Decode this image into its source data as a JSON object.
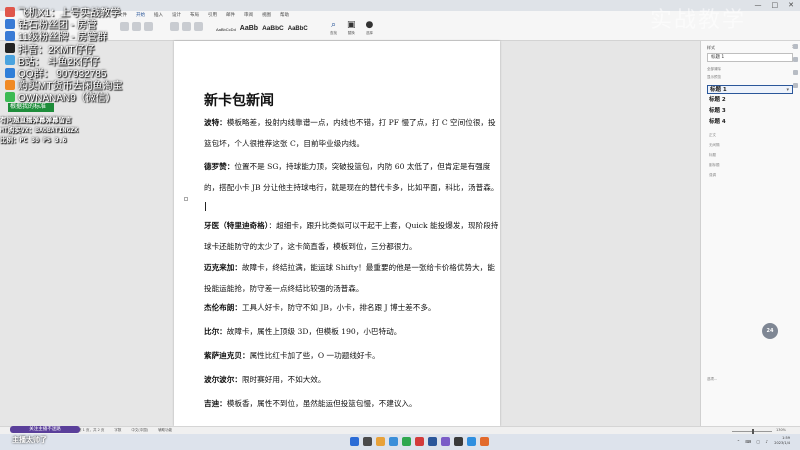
{
  "window": {
    "title_controls": [
      "—",
      "□",
      "✕"
    ],
    "watermark": "实战教学"
  },
  "ribbon": {
    "tabs": [
      "文件",
      "开始",
      "插入",
      "设计",
      "布局",
      "引用",
      "邮件",
      "审阅",
      "视图",
      "帮助"
    ],
    "styles": [
      {
        "sample": "AaBbCcDd",
        "cls": "s-body"
      },
      {
        "sample": "AaBb",
        "cls": "s-h1"
      },
      {
        "sample": "AaBbC",
        "cls": "s-h2"
      },
      {
        "sample": "AaBbC",
        "cls": "s-h3"
      }
    ],
    "right_items": [
      {
        "glyph": "⌕",
        "label": "查找"
      },
      {
        "glyph": "▣",
        "label": "替换"
      },
      {
        "glyph": "●",
        "label": "选择"
      }
    ]
  },
  "overlay": {
    "lines": [
      {
        "icon_color": "#e0564a",
        "text": "飞机X1：上号实战教学"
      },
      {
        "icon_color": "#3a7bd5",
        "text": "钻石粉丝团 - 房管"
      },
      {
        "icon_color": "#3a7bd5",
        "text": "11级粉丝牌 - 房管群"
      },
      {
        "icon_color": "#222222",
        "text": "抖音：2KMT仔仔"
      },
      {
        "icon_color": "#4aa3df",
        "text": "B站： 斗鱼2K仔仔"
      },
      {
        "icon_color": "#2f7ed8",
        "text": "QQ群： 907932785"
      },
      {
        "icon_color": "#f08a24",
        "text": "购买MT货币去闲鱼淘宝"
      },
      {
        "icon_color": "#3cba54",
        "text": "OWNANAN9（微信）"
      }
    ],
    "bar_label": "根据我的标准",
    "small_lines": [
      "有问题直播弹幕弹幕留言",
      "MT购买VX：BAOBATINGZK",
      "比例：PC 30 PS 3.6"
    ]
  },
  "document": {
    "title": "新卡包新闻",
    "paragraphs": [
      {
        "name": "波特：",
        "text": "模板略差，投射内线靠谱一点，内线也不错，打 PF 慢了点，打 C 空间位很，投篮包坏，个人很推荐这张 C，目前毕业级内线。",
        "cursor": false
      },
      {
        "name": "德罗赞：",
        "text": "位置不是 SG，持球能力顶，突破投篮包，内防 60 太低了，但肯定是有强度的，搭配小卡 JB 分让他主持球电行，就是现在的替代卡多，比如平面，科比，汤普森。",
        "cursor": true
      },
      {
        "name": "牙医（特里迪奇格）",
        "text": "：超细卡，跟升比类似可以干起干上套，Quick 能投爆发，现阶段持球卡还能防守的太少了，这卡简直香，模板到位，三分都很力。",
        "cursor": false
      },
      {
        "name": "迈克来加：",
        "text": "故障卡，终结拉满，能运球 Shifty！最重要的他是一张给卡价格优势大，能投能运能抢，防守差一点终结比较强的汤普森。",
        "cursor": false
      },
      {
        "name": "杰伦布朗：",
        "text": "工具人好卡，防守不如 JB，小卡，排名跟 J 博士差不多。",
        "cursor": false
      },
      {
        "name": "比尔：",
        "text": "故障卡，属性上顶级 3D，但模板 190，小巴特动。",
        "cursor": false
      },
      {
        "name": "紫萨迪克贝：",
        "text": "属性比红卡加了些，O 一功题线好卡。",
        "cursor": false
      },
      {
        "name": "波尔波尔：",
        "text": "限时赛好用，不如大效。",
        "cursor": false
      },
      {
        "name": "吉迪：",
        "text": "模板香，属性不到位，虽然能运但投篮包慢，不建议入。",
        "cursor": false
      }
    ]
  },
  "styles_pane": {
    "header": "样式",
    "current": "标题 1",
    "options": [
      "全部清除",
      "显示预览"
    ],
    "rows": [
      {
        "label": "标题 1",
        "selected": true
      },
      {
        "label": "标题 2",
        "selected": false
      },
      {
        "label": "标题 3",
        "selected": false
      },
      {
        "label": "标题 4",
        "selected": false
      }
    ],
    "mini_rows": [
      "正文",
      "无间隔",
      "标题",
      "副标题",
      "强调"
    ],
    "footer": "选项..."
  },
  "float_badge": "24",
  "statusbar": {
    "items": [
      "第 1 页，共 2 页",
      "字数",
      "中文(中国)",
      "辅助功能"
    ],
    "zoom": "130%"
  },
  "taskbar": {
    "icons": [
      {
        "color": "#2b6cd6"
      },
      {
        "color": "#4a4a4a"
      },
      {
        "color": "#e8a23a"
      },
      {
        "color": "#3b8fd9"
      },
      {
        "color": "#2fa84f"
      },
      {
        "color": "#d33b3b"
      },
      {
        "color": "#2b579a"
      },
      {
        "color": "#7a5cc7"
      },
      {
        "color": "#3a3a3a"
      },
      {
        "color": "#2f8fdf"
      },
      {
        "color": "#e26a2c"
      }
    ],
    "tray": "⌃ ⌨ ▢ ♪",
    "time": "1:59",
    "date": "2023/1/4"
  },
  "live": {
    "badge": "关注主播不迷路",
    "message": "主播太帅了"
  }
}
